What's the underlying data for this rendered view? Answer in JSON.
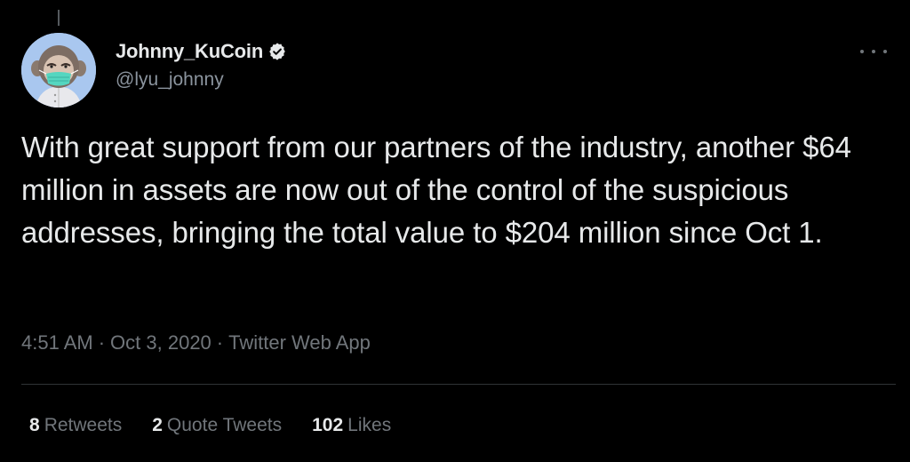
{
  "tweet": {
    "author": {
      "display_name": "Johnny_KuCoin",
      "handle": "@lyu_johnny",
      "verified": true,
      "avatar_icon": "monkey-avatar-icon"
    },
    "text": "With great support from our partners of the industry, another $64 million in assets are now out of the control of the suspicious addresses, bringing the total value to $204 million since Oct 1.",
    "time": "4:51 AM",
    "date": "Oct 3, 2020",
    "source": "Twitter Web App",
    "separator": "·",
    "stats": {
      "retweets": {
        "count": "8",
        "label": "Retweets"
      },
      "quote_tweets": {
        "count": "2",
        "label": "Quote Tweets"
      },
      "likes": {
        "count": "102",
        "label": "Likes"
      }
    }
  },
  "colors": {
    "background": "#000000",
    "primary_text": "#e7e9ea",
    "secondary_text": "#71767b",
    "divider": "#2f3336",
    "verified_badge": "#e7e9ea",
    "avatar_bg": "#a9c7ef"
  },
  "icons": {
    "verified": "verified-badge-icon",
    "more": "more-options-icon"
  }
}
